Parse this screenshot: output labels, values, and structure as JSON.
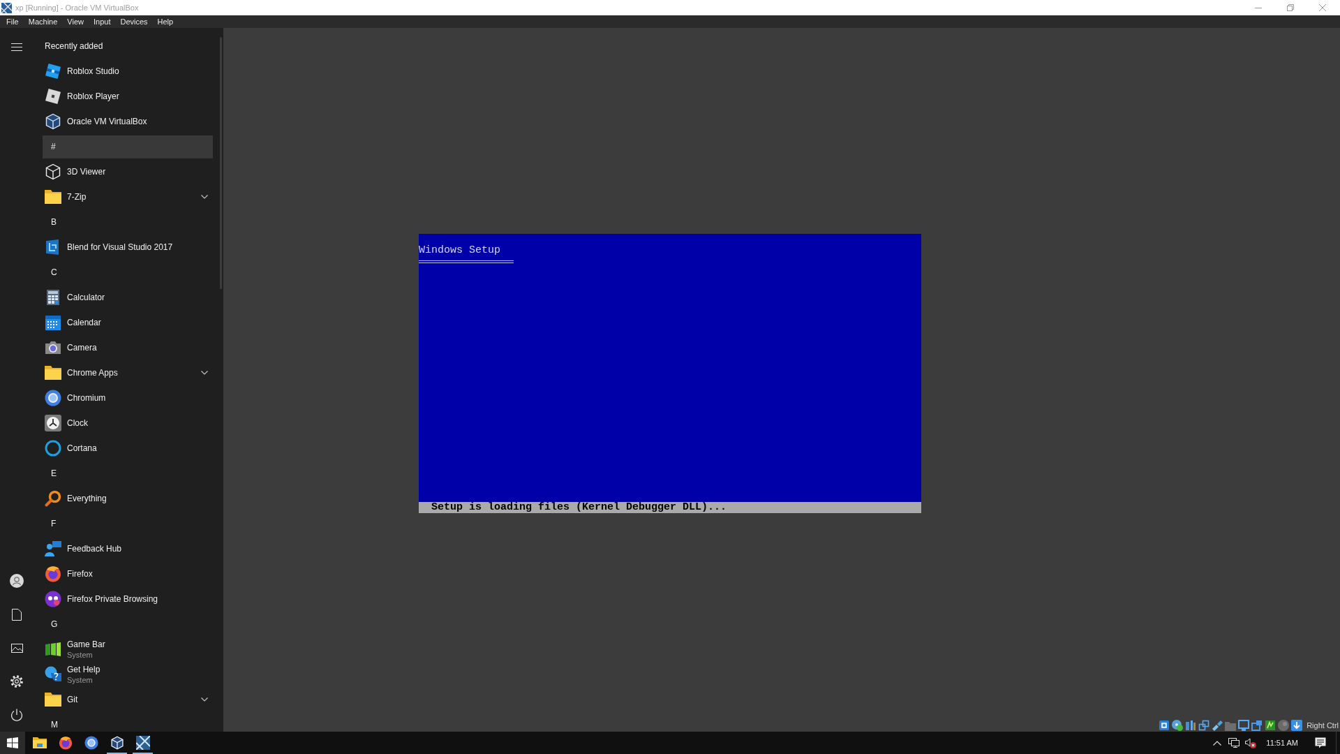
{
  "window": {
    "title": "xp [Running] - Oracle VM VirtualBox"
  },
  "menu_bar": [
    "File",
    "Machine",
    "View",
    "Input",
    "Devices",
    "Help"
  ],
  "vm_screen": {
    "heading": "Windows Setup",
    "status": "Setup is loading files (Kernel Debugger DLL)..."
  },
  "vm_status_bar": {
    "host_key": "Right Ctrl"
  },
  "start_menu": {
    "items": [
      {
        "kind": "section",
        "label": "Recently added",
        "highlighted": false
      },
      {
        "kind": "app",
        "label": "Roblox Studio",
        "highlighted": false
      },
      {
        "kind": "app",
        "label": "Roblox Player",
        "highlighted": false
      },
      {
        "kind": "app",
        "label": "Oracle VM VirtualBox",
        "highlighted": false
      },
      {
        "kind": "letter",
        "label": "#",
        "highlighted": true
      },
      {
        "kind": "app",
        "label": "3D Viewer",
        "highlighted": false
      },
      {
        "kind": "folder",
        "label": "7-Zip",
        "highlighted": false,
        "expanded": false
      },
      {
        "kind": "letter",
        "label": "B",
        "highlighted": false
      },
      {
        "kind": "app",
        "label": "Blend for Visual Studio 2017",
        "highlighted": false
      },
      {
        "kind": "letter",
        "label": "C",
        "highlighted": false
      },
      {
        "kind": "app",
        "label": "Calculator",
        "highlighted": false
      },
      {
        "kind": "app",
        "label": "Calendar",
        "highlighted": false
      },
      {
        "kind": "app",
        "label": "Camera",
        "highlighted": false
      },
      {
        "kind": "folder",
        "label": "Chrome Apps",
        "highlighted": false,
        "expanded": false
      },
      {
        "kind": "app",
        "label": "Chromium",
        "highlighted": false
      },
      {
        "kind": "app",
        "label": "Clock",
        "highlighted": false
      },
      {
        "kind": "app",
        "label": "Cortana",
        "highlighted": false
      },
      {
        "kind": "letter",
        "label": "E",
        "highlighted": false
      },
      {
        "kind": "app",
        "label": "Everything",
        "highlighted": false
      },
      {
        "kind": "letter",
        "label": "F",
        "highlighted": false
      },
      {
        "kind": "app",
        "label": "Feedback Hub",
        "highlighted": false
      },
      {
        "kind": "app",
        "label": "Firefox",
        "highlighted": false
      },
      {
        "kind": "app",
        "label": "Firefox Private Browsing",
        "highlighted": false
      },
      {
        "kind": "letter",
        "label": "G",
        "highlighted": false
      },
      {
        "kind": "app",
        "label": "Game Bar",
        "sublabel": "System",
        "highlighted": false
      },
      {
        "kind": "app",
        "label": "Get Help",
        "sublabel": "System",
        "highlighted": false
      },
      {
        "kind": "folder",
        "label": "Git",
        "highlighted": false,
        "expanded": false
      },
      {
        "kind": "letter",
        "label": "M",
        "highlighted": false
      }
    ]
  },
  "taskbar": {
    "apps": [
      {
        "running": false
      },
      {
        "running": false
      },
      {
        "running": false
      },
      {
        "running": true
      },
      {
        "running": true
      }
    ],
    "clock": "11:51 AM"
  }
}
